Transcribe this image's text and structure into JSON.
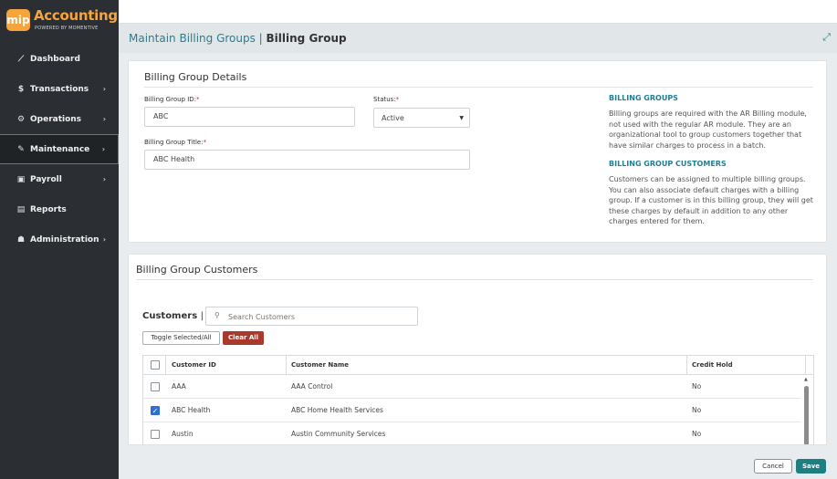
{
  "app": {
    "logo_mark": "mip",
    "name": "Accounting",
    "tagline": "POWERED BY MOMENTIVE"
  },
  "sidebar": {
    "items": [
      {
        "label": "Dashboard",
        "icon": "chart-line-icon",
        "chevron": ""
      },
      {
        "label": "Transactions",
        "icon": "dollar-icon",
        "chevron": "›"
      },
      {
        "label": "Operations",
        "icon": "cogs-icon",
        "chevron": "›"
      },
      {
        "label": "Maintenance",
        "icon": "wrench-icon",
        "chevron": "›"
      },
      {
        "label": "Payroll",
        "icon": "money-icon",
        "chevron": "›"
      },
      {
        "label": "Reports",
        "icon": "report-icon",
        "chevron": ""
      },
      {
        "label": "Administration",
        "icon": "users-icon",
        "chevron": "›"
      }
    ],
    "active": "Maintenance"
  },
  "header": {
    "breadcrumb": "Maintain Billing Groups",
    "separator": " | ",
    "title": "Billing Group"
  },
  "details": {
    "title": "Billing Group Details",
    "id_label": "Billing Group ID:",
    "id_value": "ABC",
    "status_label": "Status:",
    "status_value": "Active",
    "title_label": "Billing Group Title:",
    "title_value": "ABC Health",
    "required_mark": "*",
    "info": {
      "h1": "BILLING GROUPS",
      "p1": "Billing groups are required with the AR Billing module, not used with the regular AR module. They are an organizational tool to group customers together that have similar charges to process in a batch.",
      "h2": "BILLING GROUP CUSTOMERS",
      "p2": "Customers can be assigned to multiple billing groups. You can also associate default charges with a billing group. If a customer is in this billing group, they will get these charges by default in addition to any other charges entered for them."
    }
  },
  "customers": {
    "title": "Billing Group Customers",
    "label": "Customers",
    "label_sep": "|",
    "search_placeholder": "Search Customers",
    "toggle_label": "Toggle Selected/All",
    "clear_label": "Clear All",
    "columns": [
      "Customer ID",
      "Customer Name",
      "Credit Hold"
    ],
    "rows": [
      {
        "id": "AAA",
        "name": "AAA Control",
        "hold": "No",
        "checked": false
      },
      {
        "id": "ABC Health",
        "name": "ABC Home Health Services",
        "hold": "No",
        "checked": true
      },
      {
        "id": "Austin",
        "name": "Austin Community Services",
        "hold": "No",
        "checked": false
      }
    ]
  },
  "footer": {
    "cancel_label": "Cancel",
    "save_label": "Save"
  },
  "colors": {
    "accent": "#1e7f83",
    "brand": "#f5a53b",
    "danger": "#a93a2b",
    "sidebar": "#2b2f33"
  }
}
